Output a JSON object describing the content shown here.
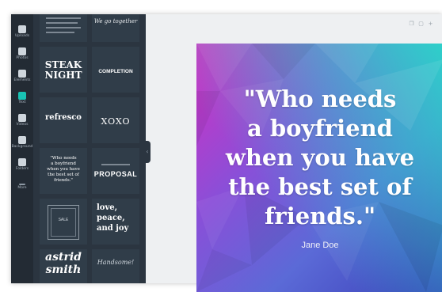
{
  "sidebar": {
    "items": [
      {
        "label": "Uploads",
        "icon": "upload-icon"
      },
      {
        "label": "Photos",
        "icon": "photos-icon"
      },
      {
        "label": "Elements",
        "icon": "elements-icon"
      },
      {
        "label": "Text",
        "icon": "text-icon"
      },
      {
        "label": "Videos",
        "icon": "videos-icon"
      },
      {
        "label": "Background",
        "icon": "background-icon"
      },
      {
        "label": "Folders",
        "icon": "folders-icon"
      },
      {
        "label": "More",
        "icon": "more-icon"
      }
    ]
  },
  "templates": {
    "tile_top_right": "We go together",
    "steak": "STEAK",
    "night": "NIGHT",
    "completion": "COMPLETION",
    "refresco": "refresco",
    "xoxo": "XOXO",
    "quote_l1": "\"Who needs",
    "quote_l2": "a boyfriend",
    "quote_l3": "when you have",
    "quote_l4": "the best set of",
    "quote_l5": "friends.\"",
    "proposal": "PROPOSAL",
    "sale": "SALE",
    "love": "love,",
    "peace": "peace,",
    "and_joy": "and joy",
    "astrid": "astrid",
    "smith": "smith",
    "handsome": "Handsome!"
  },
  "canvas": {
    "quote_lines": [
      "\"Who needs",
      "a boyfriend",
      "when you have",
      "the best set of",
      "friends.\""
    ],
    "author": "Jane Doe"
  },
  "colors": {
    "rail": "#232b34",
    "panel": "#2b3540",
    "accent": "#19c3b4"
  }
}
